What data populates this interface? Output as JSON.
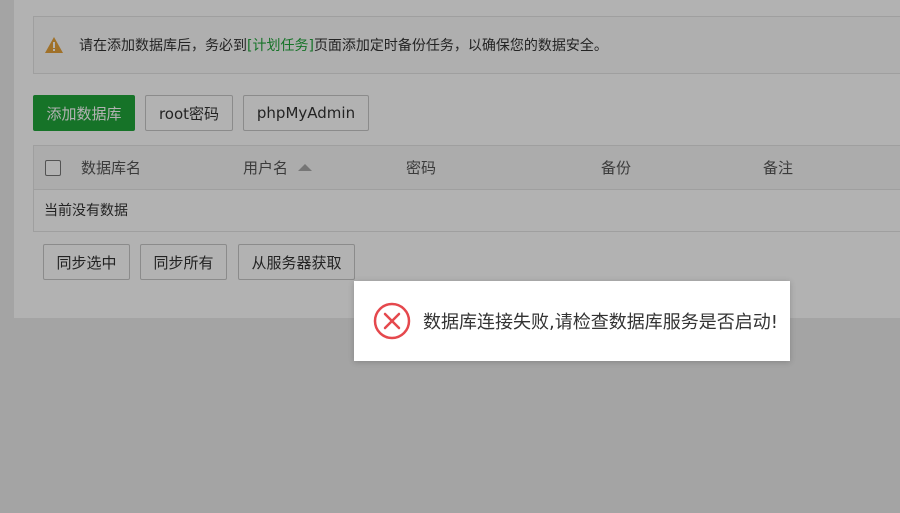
{
  "notice": {
    "prefix": "请在添加数据库后，务必到",
    "link": "[计划任务]",
    "suffix": "页面添加定时备份任务，以确保您的数据安全。"
  },
  "toolbar": {
    "add_db_label": "添加数据库",
    "root_pwd_label": "root密码",
    "phpmyadmin_label": "phpMyAdmin"
  },
  "table": {
    "columns": [
      "数据库名",
      "用户名",
      "密码",
      "备份",
      "备注"
    ],
    "empty_text": "当前没有数据"
  },
  "bulk_actions": {
    "sync_selected": "同步选中",
    "sync_all": "同步所有",
    "fetch_from_server": "从服务器获取"
  },
  "toast": {
    "message": "数据库连接失败,请检查数据库服务是否启动!"
  },
  "colors": {
    "accent": "#20a53a",
    "warning": "#e6a23c",
    "error": "#e5484d"
  }
}
